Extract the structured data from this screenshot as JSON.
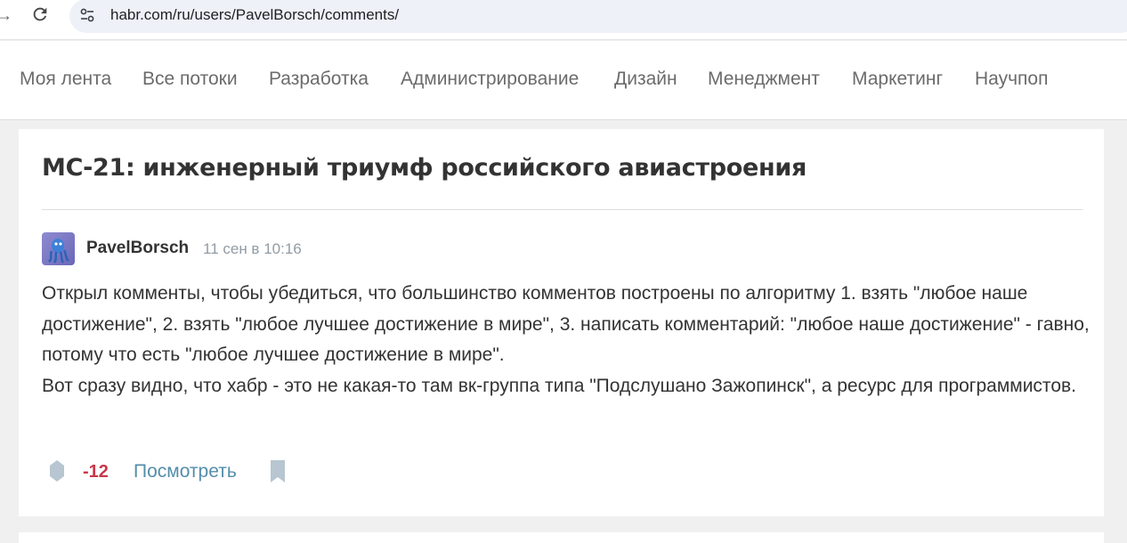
{
  "browser": {
    "url": "habr.com/ru/users/PavelBorsch/comments/",
    "back_icon": "arrow-icon",
    "reload_icon": "reload-icon",
    "site_info_icon": "tune-icon"
  },
  "nav": {
    "items": [
      "Моя лента",
      "Все потоки",
      "Разработка",
      "Администрирование",
      "Дизайн",
      "Менеджмент",
      "Маркетинг",
      "Научпоп"
    ]
  },
  "comment": {
    "post_title": "МС-21: инженерный триумф российского авиастроения",
    "author": "PavelBorsch",
    "timestamp": "11 сен в 10:16",
    "paragraphs": [
      "Открыл комменты, чтобы убедиться, что большинство комментов построены по алгоритму 1. взять \"любое наше достижение\", 2. взять \"любое лучшее достижение в мире\", 3. написать комментарий: \"любое наше достижение\" - гавно, потому что есть \"любое лучшее достижение в мире\".",
      "Вот сразу видно, что хабр - это не какая-то там вк-группа типа \"Подслушано Зажопинск\", а ресурс для программистов."
    ],
    "score": "-12",
    "view_label": "Посмотреть",
    "score_color": "#c7394a",
    "link_color": "#548eaa"
  }
}
